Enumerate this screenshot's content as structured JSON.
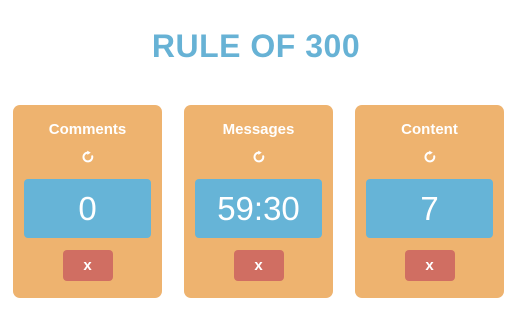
{
  "page": {
    "title": "RULE OF 300"
  },
  "cards": [
    {
      "title": "Comments",
      "value": "0",
      "reset_icon": "refresh-icon",
      "close_label": "x"
    },
    {
      "title": "Messages",
      "value": "59:30",
      "reset_icon": "refresh-icon",
      "close_label": "x"
    },
    {
      "title": "Content",
      "value": "7",
      "reset_icon": "refresh-icon",
      "close_label": "x"
    }
  ],
  "colors": {
    "title": "#67b2d5",
    "card_bg": "#eeb36f",
    "display_bg": "#66b4d7",
    "button_bg": "#d06e62",
    "text": "#ffffff"
  }
}
